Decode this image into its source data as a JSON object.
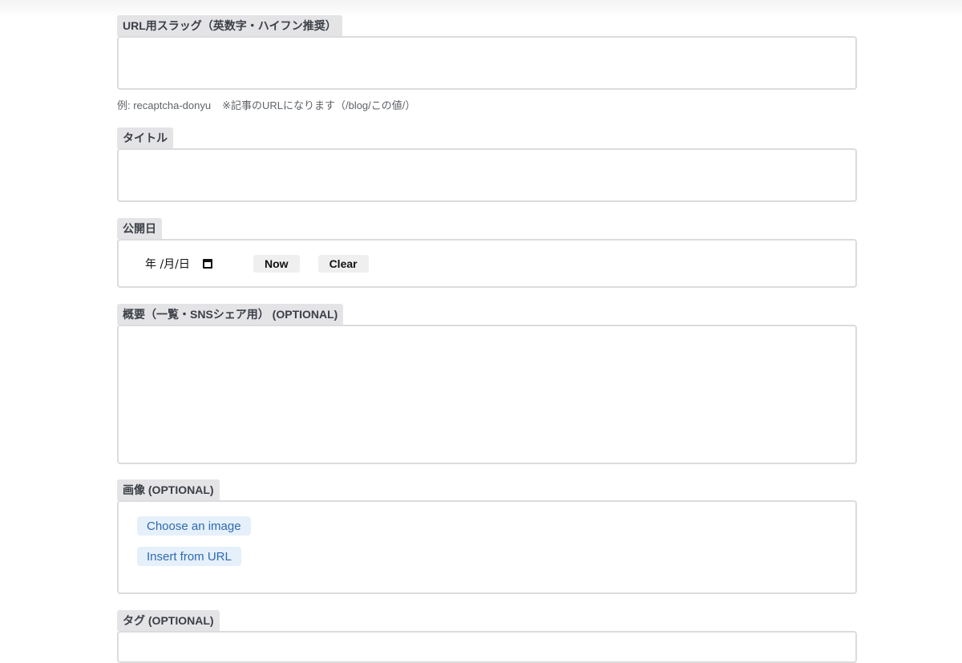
{
  "slug": {
    "label": "URL用スラッグ（英数字・ハイフン推奨）",
    "value": "",
    "hint_example": "例: recaptcha-donyu",
    "hint_note": "※記事のURLになります（/blog/この値/）"
  },
  "title": {
    "label": "タイトル",
    "value": ""
  },
  "publish_date": {
    "label": "公開日",
    "date_placeholder": "年 /月/日",
    "now_label": "Now",
    "clear_label": "Clear"
  },
  "summary": {
    "label": "概要（一覧・SNSシェア用） (OPTIONAL)",
    "value": ""
  },
  "image": {
    "label": "画像 (OPTIONAL)",
    "choose_label": "Choose an image",
    "insert_url_label": "Insert from URL"
  },
  "tags": {
    "label": "タグ (OPTIONAL)"
  }
}
